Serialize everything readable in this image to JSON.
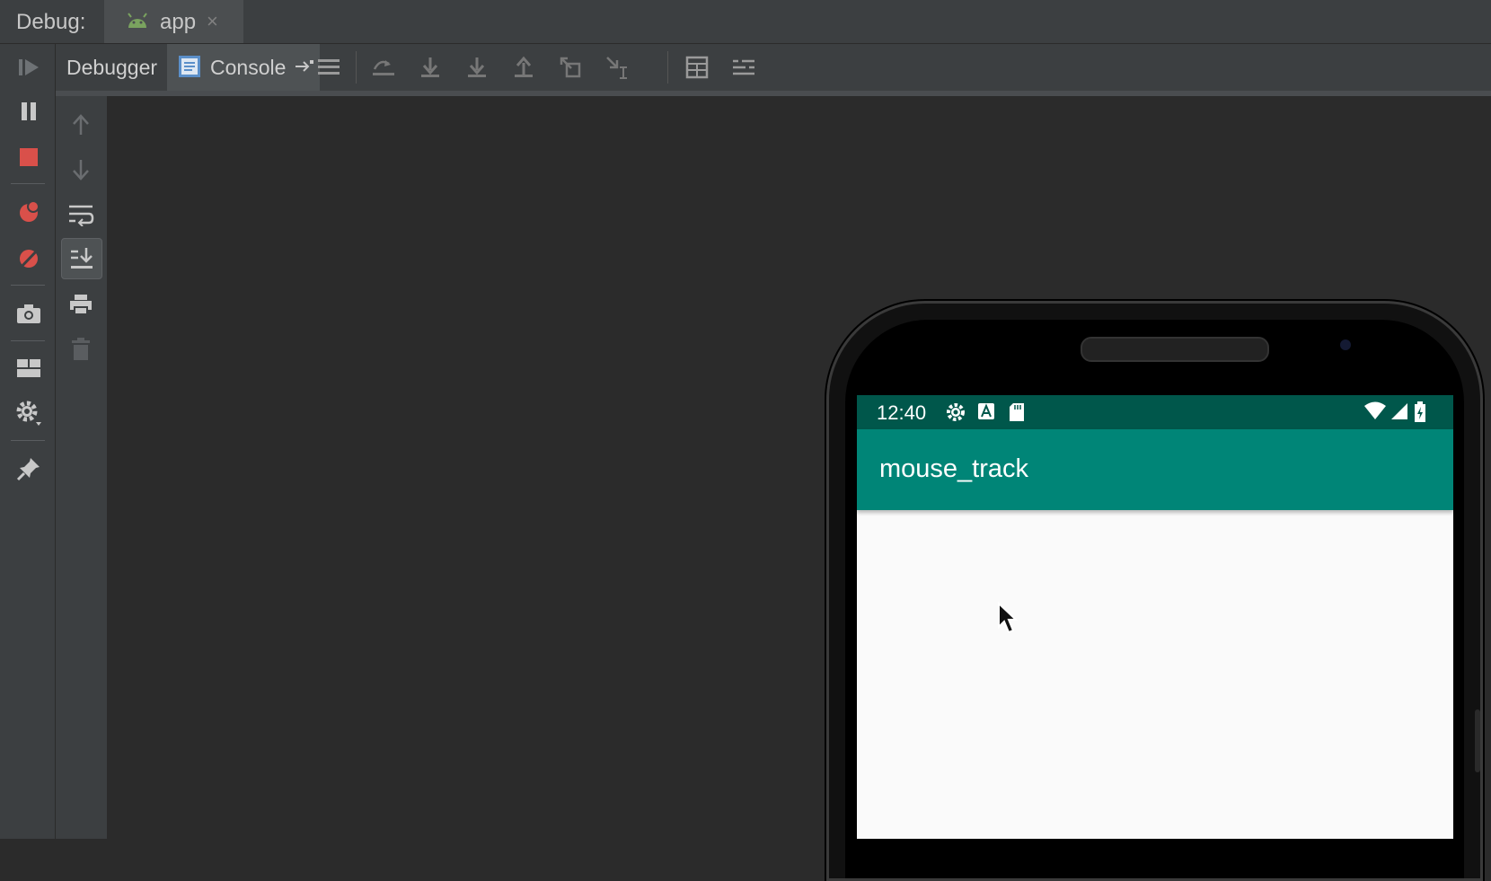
{
  "title_bar": {
    "debug_label": "Debug:",
    "tab_label": "app",
    "close_glyph": "×"
  },
  "toolbar": {
    "debugger_tab": "Debugger",
    "console_tab": "Console"
  },
  "icons": {
    "left_strip": [
      "resume-icon",
      "pause-icon",
      "stop-icon",
      "view-breakpoints-icon",
      "mute-breakpoints-icon",
      "camera-icon",
      "layout-icon",
      "settings-icon",
      "pin-icon"
    ],
    "toolbar": [
      "show-execution-point-icon",
      "step-over-icon",
      "step-into-icon",
      "force-step-into-icon",
      "step-out-icon",
      "drop-frame-icon",
      "run-to-cursor-icon",
      "evaluate-expression-icon",
      "trace-icon"
    ],
    "console_side": [
      "up-arrow-icon",
      "down-arrow-icon",
      "soft-wrap-icon",
      "scroll-to-end-icon",
      "print-icon",
      "clear-all-icon"
    ]
  },
  "emulator": {
    "status_time": "12:40",
    "app_title": "mouse_track"
  },
  "colors": {
    "ide_bg": "#2b2b2b",
    "panel_bg": "#3c3f41",
    "status_bar": "#00574b",
    "app_bar": "#008577",
    "stop_red": "#d9504a"
  }
}
